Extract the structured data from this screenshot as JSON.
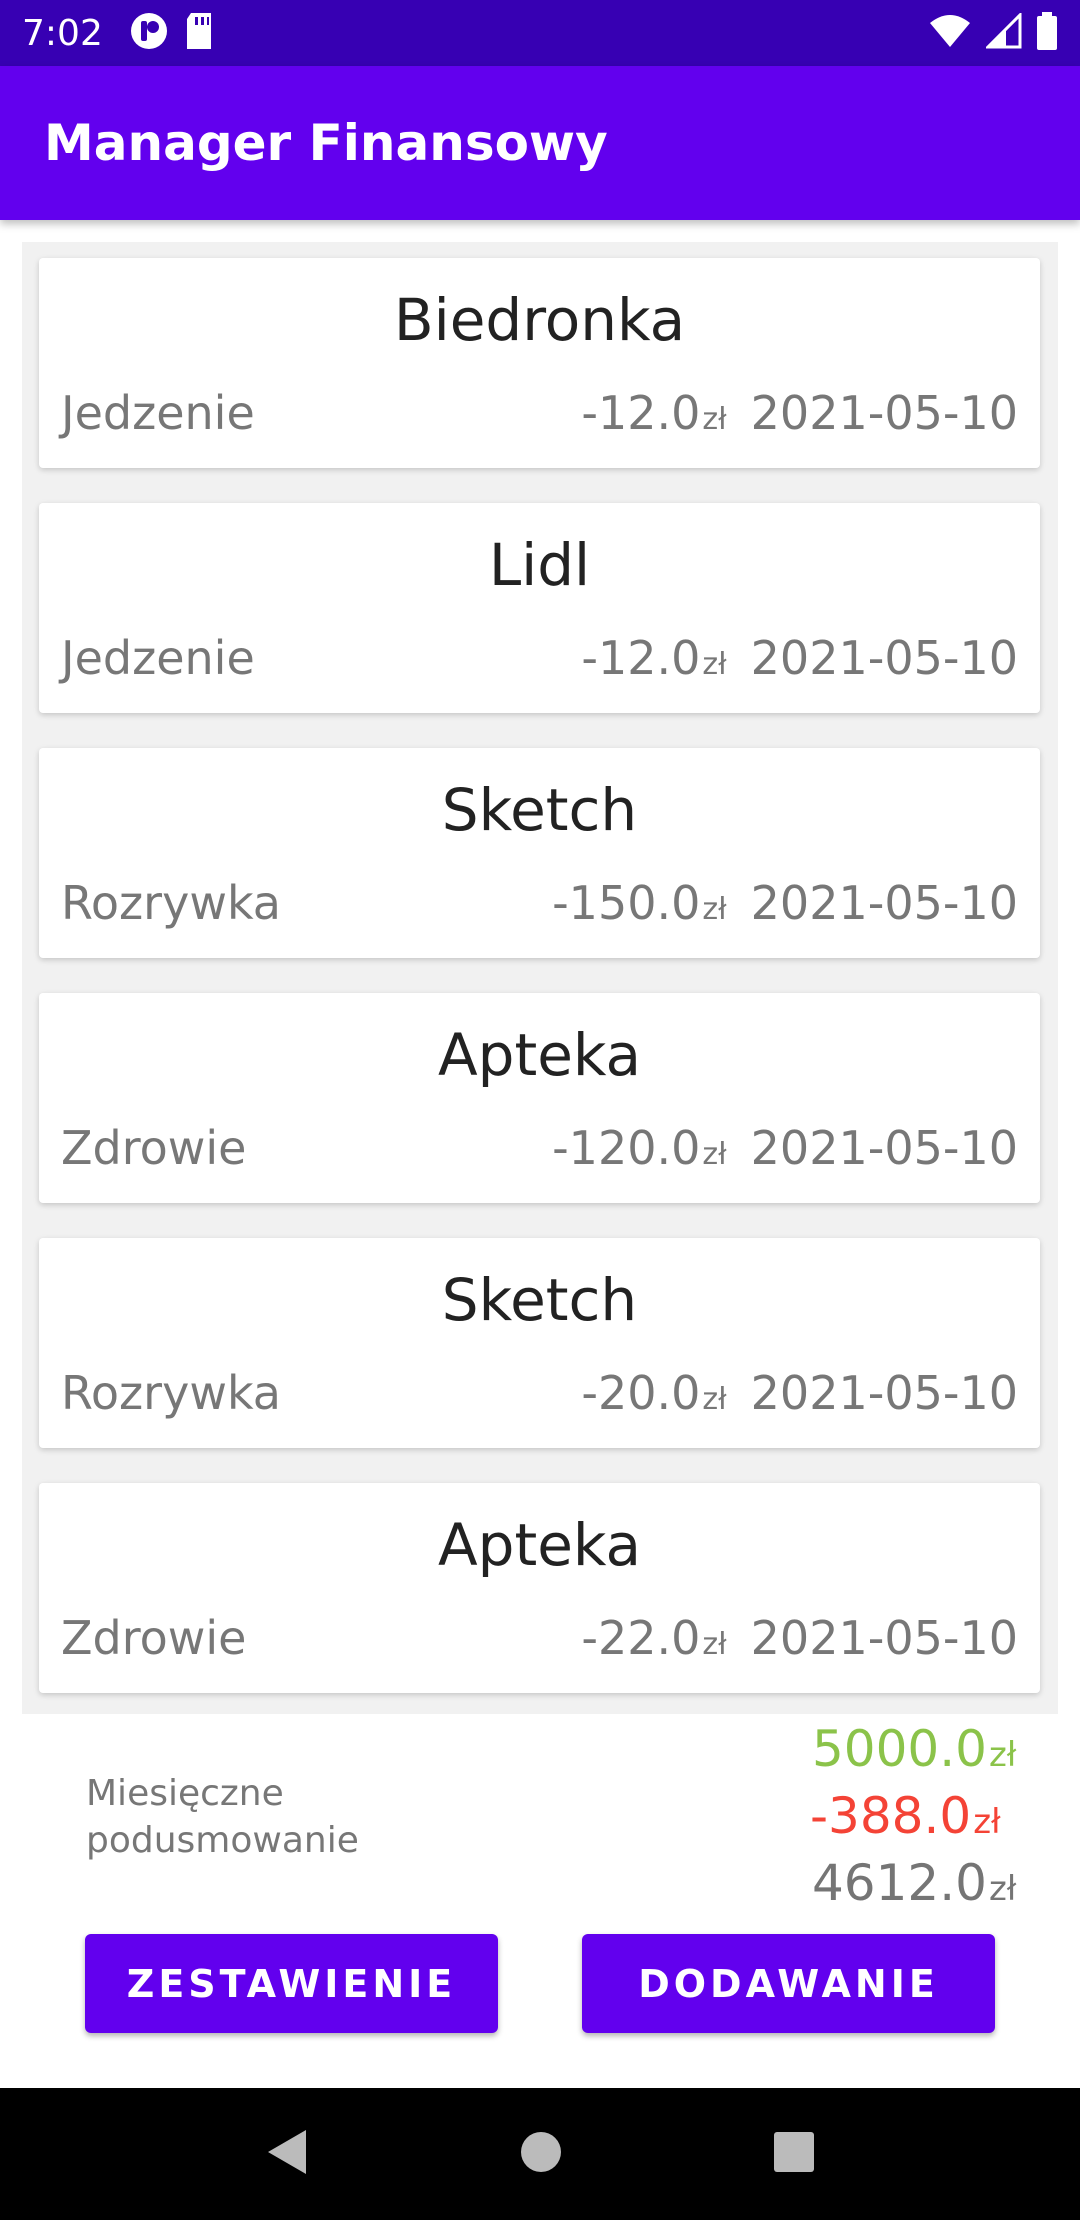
{
  "status_bar": {
    "time": "7:02",
    "icons": [
      "app-notification-icon",
      "sd-card-icon",
      "wifi-icon",
      "signal-icon",
      "battery-icon"
    ]
  },
  "app_bar": {
    "title": "Manager Finansowy"
  },
  "transactions": [
    {
      "name": "Biedronka",
      "category": "Jedzenie",
      "amount": "-12.0",
      "currency": "zł",
      "date": "2021-05-10"
    },
    {
      "name": "Lidl",
      "category": "Jedzenie",
      "amount": "-12.0",
      "currency": "zł",
      "date": "2021-05-10"
    },
    {
      "name": "Sketch",
      "category": "Rozrywka",
      "amount": "-150.0",
      "currency": "zł",
      "date": "2021-05-10"
    },
    {
      "name": "Apteka",
      "category": "Zdrowie",
      "amount": "-120.0",
      "currency": "zł",
      "date": "2021-05-10"
    },
    {
      "name": "Sketch",
      "category": "Rozrywka",
      "amount": "-20.0",
      "currency": "zł",
      "date": "2021-05-10"
    },
    {
      "name": "Apteka",
      "category": "Zdrowie",
      "amount": "-22.0",
      "currency": "zł",
      "date": "2021-05-10"
    }
  ],
  "summary": {
    "label": "Miesięczne podusmowanie",
    "income": "5000.0",
    "expenses": "-388.0",
    "balance": "4612.0",
    "currency": "zł",
    "colors": {
      "income": "#8BC34A",
      "expenses": "#F44336",
      "balance": "#757575"
    }
  },
  "buttons": {
    "summary_label": "ZESTAWIENIE",
    "add_label": "DODAWANIE"
  },
  "nav_bar": {
    "icons": [
      "back-icon",
      "home-icon",
      "recents-icon"
    ]
  },
  "colors": {
    "primary": "#6200EE",
    "primary_dark": "#3700B3"
  }
}
